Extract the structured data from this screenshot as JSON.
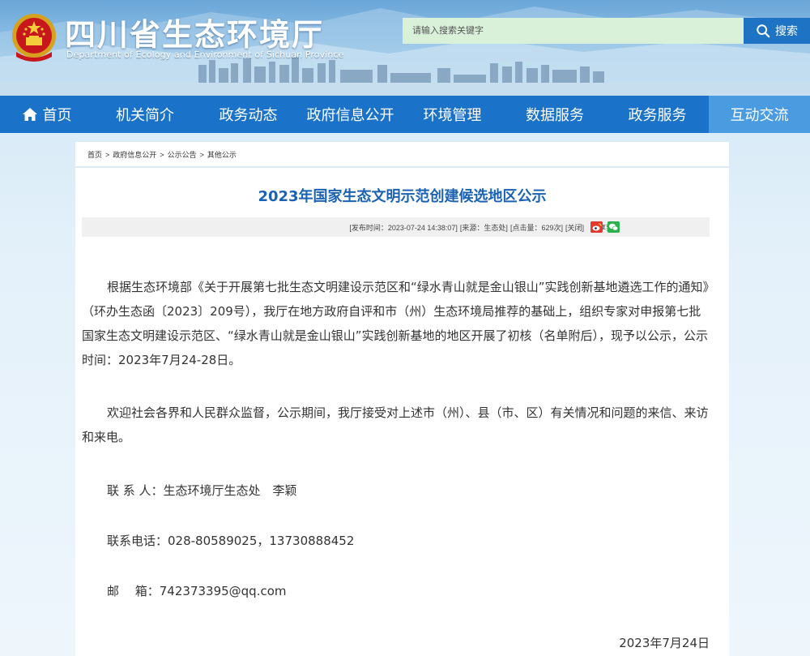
{
  "header": {
    "title": "四川省生态环境厅",
    "subtitle": "Department of Ecology and Environment of Sichuan Province",
    "search_placeholder": "请输入搜索关键字",
    "search_button": "搜索"
  },
  "nav": {
    "items": [
      {
        "label": "首页",
        "icon": "home-icon"
      },
      {
        "label": "机关简介"
      },
      {
        "label": "政务动态"
      },
      {
        "label": "政府信息公开"
      },
      {
        "label": "环境管理"
      },
      {
        "label": "数据服务"
      },
      {
        "label": "政务服务"
      },
      {
        "label": "互动交流",
        "active": true
      }
    ]
  },
  "breadcrumb": [
    "首页",
    "政府信息公开",
    "公示公告",
    "其他公示"
  ],
  "article": {
    "title": "2023年国家生态文明示范创建候选地区公示",
    "meta": {
      "publish_time": "[发布时间：2023-07-24 14:38:07]",
      "source": "[来源：生态处]",
      "clicks": "[点击量：629次]",
      "close": "[关闭]",
      "share_label": "分享到："
    },
    "paragraphs": [
      "根据生态环境部《关于开展第七批生态文明建设示范区和“绿水青山就是金山银山”实践创新基地遴选工作的通知》（环办生态函〔2023〕209号），我厅在地方政府自评和市（州）生态环境局推荐的基础上，组织专家对申报第七批国家生态文明建设示范区、“绿水青山就是金山银山”实践创新基地的地区开展了初核（名单附后），现予以公示，公示时间：2023年7月24-28日。",
      "欢迎社会各界和人民群众监督，公示期间，我厅接受对上述市（州）、县（市、区）有关情况和问题的来信、来访和来电。"
    ],
    "contact_person": "联 系 人：生态环境厅生态处　李颖",
    "contact_phone": "联系电话：028-80589025，13730888452",
    "contact_email": "邮　 箱：742373395@qq.com",
    "date": "2023年7月24日"
  },
  "colors": {
    "nav_bg": "#1a73c8",
    "nav_active": "#4b9be0",
    "title": "#1a62b3",
    "search_bg": "#d9f0d9",
    "search_button": "#1f73c4"
  }
}
